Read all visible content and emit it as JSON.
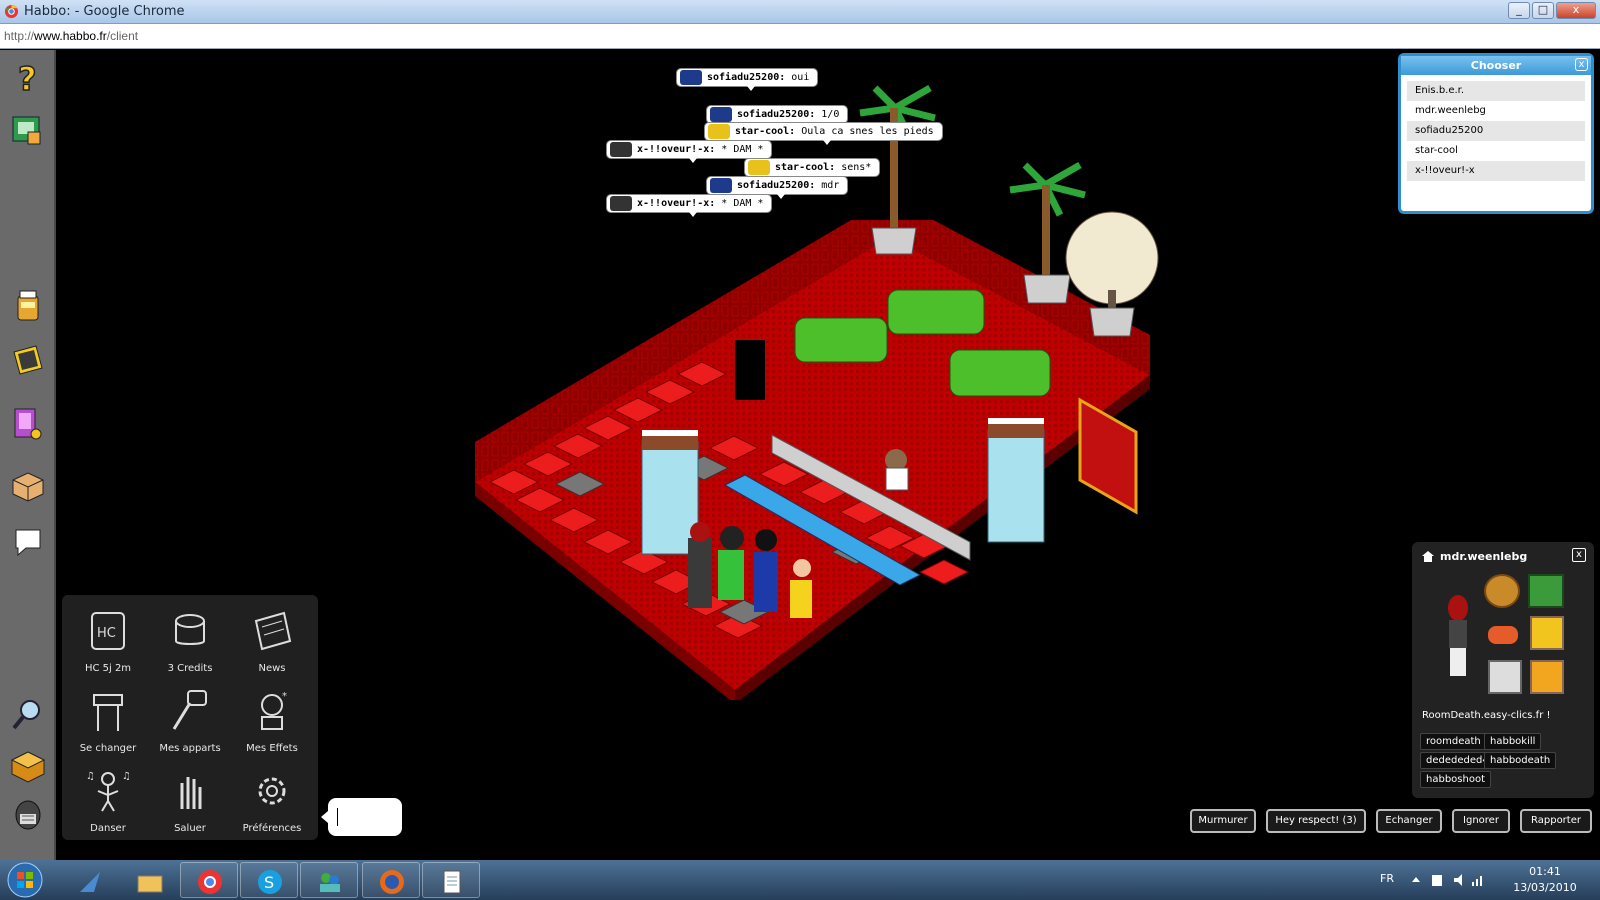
{
  "window": {
    "title": "Habbo: - Google Chrome",
    "minimize": "_",
    "maximize": "□",
    "close": "x"
  },
  "address": {
    "prefix": "http://",
    "host": "www.habbo.fr",
    "path": "/client"
  },
  "leftbar": {
    "icons": [
      "help-icon",
      "hotel-view-icon",
      "catalogue-icon",
      "navigator-icon",
      "habbo-shop-icon",
      "inventory-icon",
      "chat-bubble-icon",
      "search-icon",
      "credits-box-icon",
      "avatar-head-icon"
    ]
  },
  "chat": [
    {
      "user": "sofiadu25200:",
      "text": "oui",
      "color": "#1d3b8a"
    },
    {
      "user": "sofiadu25200:",
      "text": "1/0",
      "color": "#1d3b8a"
    },
    {
      "user": "star-cool:",
      "text": "Oula ca snes les pieds",
      "color": "#e8c21a"
    },
    {
      "user": "x-!!oveur!-x:",
      "text": "* DAM *",
      "color": "#333333"
    },
    {
      "user": "star-cool:",
      "text": "sens*",
      "color": "#e8c21a"
    },
    {
      "user": "sofiadu25200:",
      "text": "mdr",
      "color": "#1d3b8a"
    },
    {
      "user": "x-!!oveur!-x:",
      "text": "* DAM *",
      "color": "#333333"
    }
  ],
  "chooser": {
    "title": "Chooser",
    "close": "x",
    "items": [
      "Enis.b.e.r.",
      "mdr.weenlebg",
      "sofiadu25200",
      "star-cool",
      "x-!!oveur!-x"
    ]
  },
  "menu": {
    "items": [
      {
        "label": "HC 5j 2m",
        "icon": "hc-club-icon"
      },
      {
        "label": "3 Credits",
        "icon": "credits-icon"
      },
      {
        "label": "News",
        "icon": "news-icon"
      },
      {
        "label": "Se changer",
        "icon": "wardrobe-icon"
      },
      {
        "label": "Mes apparts",
        "icon": "room-key-icon"
      },
      {
        "label": "Mes Effets",
        "icon": "effects-icon"
      },
      {
        "label": "Danser",
        "icon": "dance-icon"
      },
      {
        "label": "Saluer",
        "icon": "wave-hand-icon"
      },
      {
        "label": "Préférences",
        "icon": "preferences-gear-icon"
      }
    ]
  },
  "profile": {
    "name": "mdr.weenlebg",
    "motto": "RoomDeath.easy-clics.fr !",
    "tags": [
      "roomdeath",
      "habbokill",
      "dedededed4",
      "habbodeath",
      "habboshoot"
    ],
    "close": "x"
  },
  "actions": [
    "Murmurer",
    "Hey respect! (3)",
    "Echanger",
    "Ignorer",
    "Rapporter"
  ],
  "taskbar": {
    "lang": "FR",
    "time": "01:41",
    "date": "13/03/2010"
  },
  "colors": {
    "room_red": "#c00000",
    "wall_dark": "#8e0000",
    "sofa_green": "#4cbf2a",
    "accent_blue": "#2f8ecd"
  }
}
